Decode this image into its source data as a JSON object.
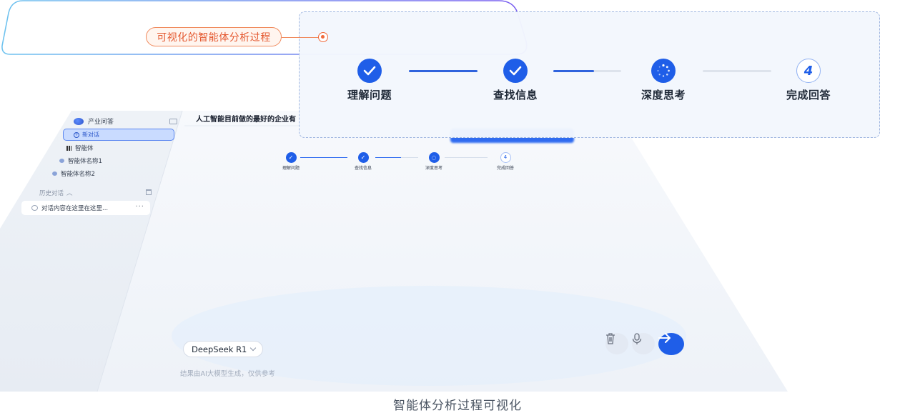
{
  "app": {
    "brand_name": "产业问答",
    "new_chat_label": "新对话",
    "nav_items": [
      {
        "label": "智能体",
        "icon": "grid-icon"
      },
      {
        "label": "智能体名称1",
        "icon": "agent-icon"
      },
      {
        "label": "智能体名称2",
        "icon": "agent-icon"
      }
    ],
    "history_title": "历史对话",
    "history_items": [
      {
        "label": "对话内容在这里在这里...",
        "more": "···"
      }
    ],
    "query_title": "人工智能目前做的最好的企业有",
    "steps": [
      {
        "label": "理解问题",
        "status": "done"
      },
      {
        "label": "查找信息",
        "status": "done"
      },
      {
        "label": "深度思考",
        "status": "in-progress"
      },
      {
        "label": "完成回答",
        "status": "pending",
        "number": "4"
      }
    ],
    "step_progress": [
      1.0,
      0.6,
      0.0
    ],
    "input": {
      "model": "DeepSeek R1",
      "disclaimer": "结果由AI大模型生成，仅供参考"
    }
  },
  "annotation": {
    "callout_label": "可视化的智能体分析过程",
    "caption": "智能体分析过程可视化"
  },
  "colors": {
    "accent": "#1f5ee8",
    "callout": "#e4572e"
  }
}
